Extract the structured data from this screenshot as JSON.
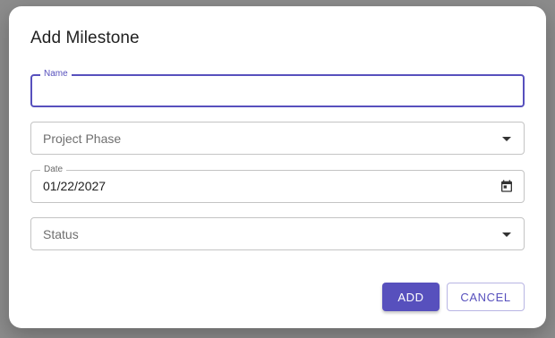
{
  "dialog": {
    "title": "Add Milestone",
    "accent_color": "#5750bd",
    "fields": {
      "name": {
        "label": "Name",
        "value": "",
        "placeholder": ""
      },
      "project_phase": {
        "placeholder": "Project Phase",
        "icon": "chevron-down-icon"
      },
      "date": {
        "label": "Date",
        "value": "01/22/2027",
        "icon": "calendar-icon"
      },
      "status": {
        "placeholder": "Status",
        "icon": "chevron-down-icon"
      }
    },
    "buttons": {
      "add_label": "ADD",
      "cancel_label": "CANCEL"
    }
  }
}
